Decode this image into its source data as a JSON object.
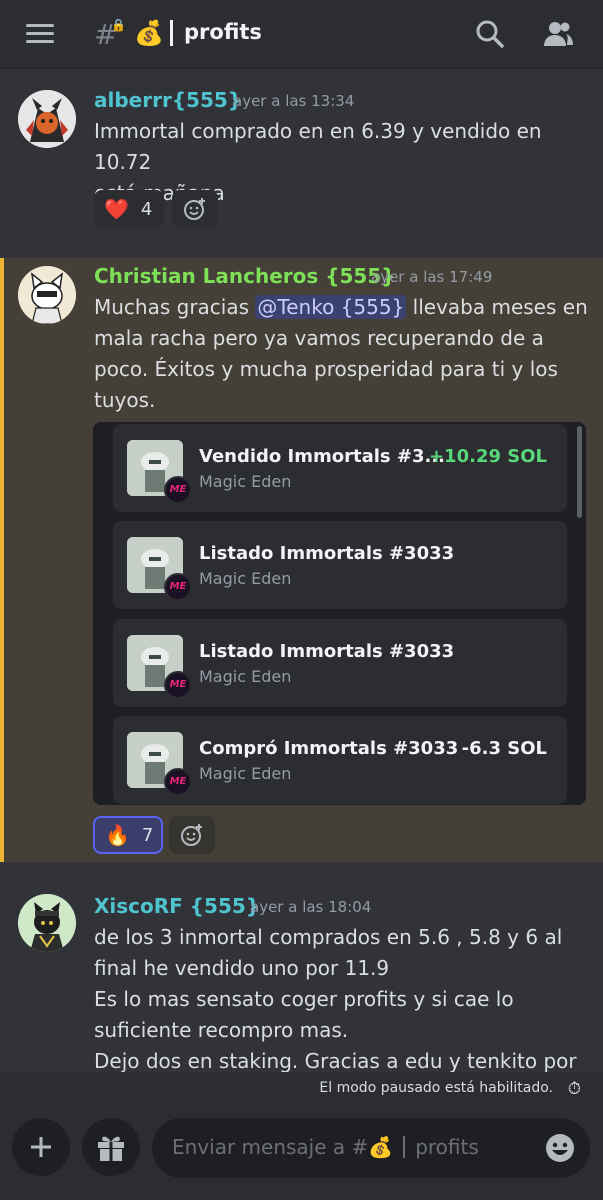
{
  "header": {
    "channel_hash": "#",
    "channel_emoji": "💰",
    "channel_name": "profits"
  },
  "messages": [
    {
      "author": "alberrr{555}",
      "author_color": "#4fc4cf",
      "timestamp": "ayer a las 13:34",
      "lines": [
        "Immortal comprado en en 6.39 y vendido en 10.72",
        "está mañana"
      ],
      "reaction": {
        "emoji": "❤️",
        "count": "4"
      }
    },
    {
      "author": "Christian Lancheros {555}",
      "author_color": "#7ee057",
      "timestamp": "ayer a las 17:49",
      "line1_pre": "Muchas gracias ",
      "mention": "@Tenko {555}",
      "line1_post": " llevaba meses en",
      "lines": [
        "mala racha pero ya vamos recuperando de a",
        "poco. Éxitos y mucha prosperidad para ti y los",
        "tuyos."
      ],
      "reaction": {
        "emoji": "🔥",
        "count": "7"
      },
      "embeds": [
        {
          "title": "Vendido Immortals #3...",
          "subtitle": "Magic Eden",
          "amount": "+10.29 SOL",
          "amount_color": "#57d67a"
        },
        {
          "title": "Listado Immortals #3033",
          "subtitle": "Magic Eden",
          "amount": "",
          "amount_color": "#f2f3f5"
        },
        {
          "title": "Listado Immortals #3033",
          "subtitle": "Magic Eden",
          "amount": "",
          "amount_color": "#f2f3f5"
        },
        {
          "title": "Compró Immortals #3033",
          "subtitle": "Magic Eden",
          "amount": "-6.3 SOL",
          "amount_color": "#f2f3f5"
        }
      ]
    },
    {
      "author": "XiscoRF {555}",
      "author_color": "#4fc4cf",
      "timestamp": "ayer a las 18:04",
      "lines": [
        "de los 3 inmortal comprados en 5.6 , 5.8  y 6 al",
        "final he vendido uno por 11.9",
        "Es lo mas sensato coger profits y si cae lo",
        "suficiente recompro mas.",
        "Dejo dos en staking. Gracias a edu y tenkito por"
      ]
    }
  ],
  "paused_notice": "El modo pausado está habilitado.",
  "composer": {
    "placeholder_pre": "Enviar mensaje a #",
    "placeholder_emoji": "💰",
    "placeholder_channel": "profits"
  }
}
